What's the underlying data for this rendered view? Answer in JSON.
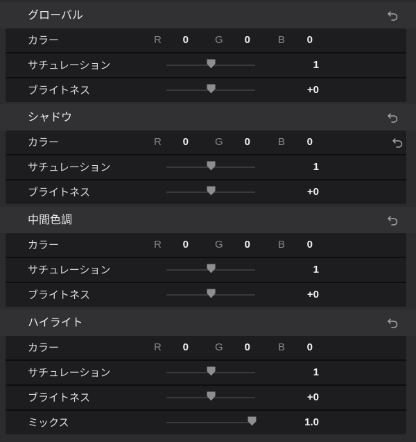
{
  "sections": [
    {
      "title": "グローバル",
      "icon": "reset-icon",
      "rows": [
        {
          "type": "color",
          "label": "カラー",
          "r_label": "R",
          "r": "0",
          "g_label": "G",
          "g": "0",
          "b_label": "B",
          "b": "0"
        },
        {
          "type": "slider",
          "label": "サチュレーション",
          "value": "1",
          "level": 0.5
        },
        {
          "type": "slider",
          "label": "ブライトネス",
          "value": "+0",
          "level": 0.5
        }
      ]
    },
    {
      "title": "シャドウ",
      "icon": "reset-icon",
      "rows": [
        {
          "type": "color",
          "label": "カラー",
          "r_label": "R",
          "r": "0",
          "g_label": "G",
          "g": "0",
          "b_label": "B",
          "b": "0",
          "row_icon": "reset-icon"
        },
        {
          "type": "slider",
          "label": "サチュレーション",
          "value": "1",
          "level": 0.5
        },
        {
          "type": "slider",
          "label": "ブライトネス",
          "value": "+0",
          "level": 0.5
        }
      ]
    },
    {
      "title": "中間色調",
      "icon": "reset-icon",
      "rows": [
        {
          "type": "color",
          "label": "カラー",
          "r_label": "R",
          "r": "0",
          "g_label": "G",
          "g": "0",
          "b_label": "B",
          "b": "0"
        },
        {
          "type": "slider",
          "label": "サチュレーション",
          "value": "1",
          "level": 0.5
        },
        {
          "type": "slider",
          "label": "ブライトネス",
          "value": "+0",
          "level": 0.5
        }
      ]
    },
    {
      "title": "ハイライト",
      "icon": "reset-icon",
      "rows": [
        {
          "type": "color",
          "label": "カラー",
          "r_label": "R",
          "r": "0",
          "g_label": "G",
          "g": "0",
          "b_label": "B",
          "b": "0"
        },
        {
          "type": "slider",
          "label": "サチュレーション",
          "value": "1",
          "level": 0.5
        },
        {
          "type": "slider",
          "label": "ブライトネス",
          "value": "+0",
          "level": 0.5
        },
        {
          "type": "slider",
          "label": "ミックス",
          "value": "1.0",
          "level": 1.0
        }
      ]
    }
  ],
  "colors": {
    "background": "#2c2c2e",
    "row": "#1d1d1f",
    "thumb": "#8e8e8e"
  }
}
